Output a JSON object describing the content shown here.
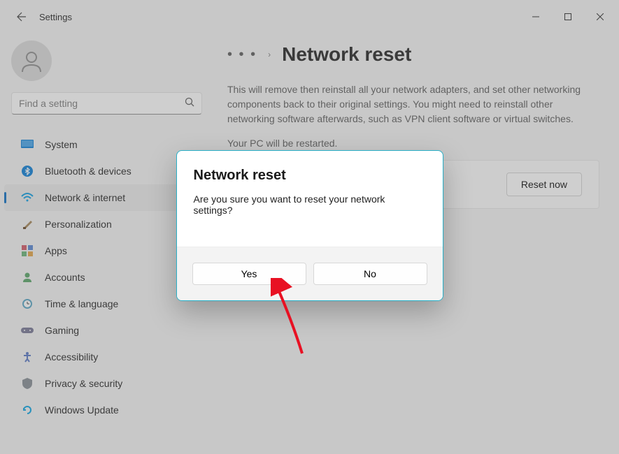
{
  "window": {
    "title": "Settings"
  },
  "search": {
    "placeholder": "Find a setting"
  },
  "sidebar": {
    "items": [
      {
        "label": "System",
        "icon": "system",
        "color": "#0078d4"
      },
      {
        "label": "Bluetooth & devices",
        "icon": "bluetooth",
        "color": "#0078d4"
      },
      {
        "label": "Network & internet",
        "icon": "wifi",
        "color": "#0078d4",
        "active": true
      },
      {
        "label": "Personalization",
        "icon": "brush",
        "color": "#a08050"
      },
      {
        "label": "Apps",
        "icon": "apps",
        "color": "#d05060"
      },
      {
        "label": "Accounts",
        "icon": "person",
        "color": "#50a060"
      },
      {
        "label": "Time & language",
        "icon": "clock",
        "color": "#50a0c0"
      },
      {
        "label": "Gaming",
        "icon": "gaming",
        "color": "#707090"
      },
      {
        "label": "Accessibility",
        "icon": "accessibility",
        "color": "#5070c0"
      },
      {
        "label": "Privacy & security",
        "icon": "shield",
        "color": "#808890"
      },
      {
        "label": "Windows Update",
        "icon": "update",
        "color": "#00a0e0"
      }
    ]
  },
  "breadcrumb": {
    "dots": "• • •",
    "chevron": "›",
    "title": "Network reset"
  },
  "main": {
    "description": "This will remove then reinstall all your network adapters, and set other networking components back to their original settings. You might need to reinstall other networking software afterwards, such as VPN client software or virtual switches.",
    "restart_notice": "Your PC will be restarted.",
    "reset_button": "Reset now"
  },
  "dialog": {
    "title": "Network reset",
    "message": "Are you sure you want to reset your network settings?",
    "yes": "Yes",
    "no": "No"
  }
}
